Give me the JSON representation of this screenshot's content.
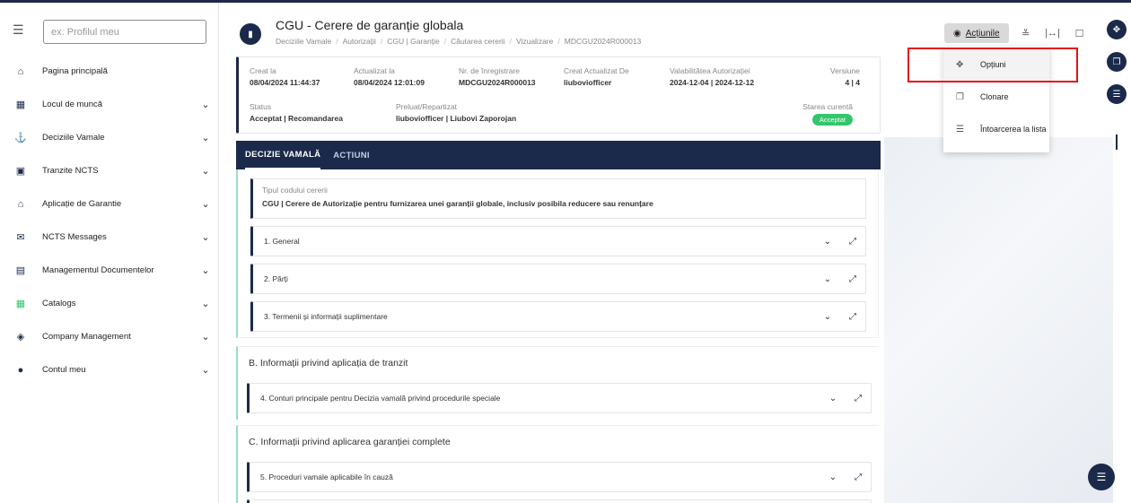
{
  "sidebar": {
    "search_placeholder": "ex. Profilul meu",
    "items": [
      {
        "label": "Pagina principală",
        "icon": "home-icon",
        "chevron": false
      },
      {
        "label": "Locul de muncă",
        "icon": "dashboard-icon",
        "chevron": true
      },
      {
        "label": "Deciziile Vamale",
        "icon": "anchor-icon",
        "chevron": true
      },
      {
        "label": "Tranzite NCTS",
        "icon": "truck-icon",
        "chevron": true
      },
      {
        "label": "Aplicație de Garantie",
        "icon": "bank-icon",
        "chevron": true
      },
      {
        "label": "NCTS Messages",
        "icon": "mail-icon",
        "chevron": true
      },
      {
        "label": "Managementul Documentelor",
        "icon": "document-icon",
        "chevron": true
      },
      {
        "label": "Catalogs",
        "icon": "grid-icon",
        "chevron": true
      },
      {
        "label": "Company Management",
        "icon": "shield-icon",
        "chevron": true
      },
      {
        "label": "Contul meu",
        "icon": "user-icon",
        "chevron": true
      }
    ]
  },
  "header": {
    "title": "CGU - Cerere de garanție globala",
    "breadcrumb": [
      "Deciziile Vamale",
      "Autorizații",
      "CGU | Garanție",
      "Căutarea cererii",
      "Vizualizare",
      "MDCGU2024R000013"
    ],
    "actions_label": "Acțiunile"
  },
  "info": {
    "created_label": "Creat la",
    "created_value": "08/04/2024 11:44:37",
    "updated_label": "Actualizat la",
    "updated_value": "08/04/2024 12:01:09",
    "reg_label": "Nr. de înregistrare",
    "reg_value": "MDCGU2024R000013",
    "created_by_label": "Creat Actualizat De",
    "created_by_value": "liuboviofficer",
    "validity_label": "Valabilitătea Autorizației",
    "validity_value": "2024-12-04 | 2024-12-12",
    "version_label": "Versiune",
    "version_value": "4 | 4",
    "status_label": "Status",
    "status_value": "Acceptat | Recomandarea",
    "assigned_label": "Preluat/Repartizat",
    "assigned_value": "liuboviofficer | Liubovi Zaporojan",
    "state_label": "Starea curentă",
    "state_value": "Acceptat"
  },
  "tabs": [
    {
      "label": "DECIZIE VAMALĂ",
      "active": true
    },
    {
      "label": "ACȚIUNI",
      "active": false
    }
  ],
  "request_type": {
    "label": "Tipul codului cererii",
    "value": "CGU | Cerere de Autorizație pentru furnizarea unei garanții globale, inclusiv posibila reducere sau renunțare"
  },
  "sections": {
    "a_items": [
      "1. General",
      "2. Părți",
      "3. Termenii și informații suplimentare"
    ],
    "b_title": "B. Informații privind aplicația de tranzit",
    "b_items": [
      "4. Conturi principale pentru Decizia vamală privind procedurile speciale"
    ],
    "c_title": "C. Informații privind aplicarea garanției complete",
    "c_items": [
      "5. Proceduri vamale aplicabile în cauză"
    ]
  },
  "dropdown": {
    "items": [
      {
        "label": "Opțiuni",
        "icon": "move-icon"
      },
      {
        "label": "Clonare",
        "icon": "copy-icon"
      },
      {
        "label": "Întoarcerea la lista",
        "icon": "list-icon"
      }
    ]
  },
  "colors": {
    "primary": "#1b2a4a",
    "success": "#34c66b",
    "highlight": "#e5101b"
  }
}
